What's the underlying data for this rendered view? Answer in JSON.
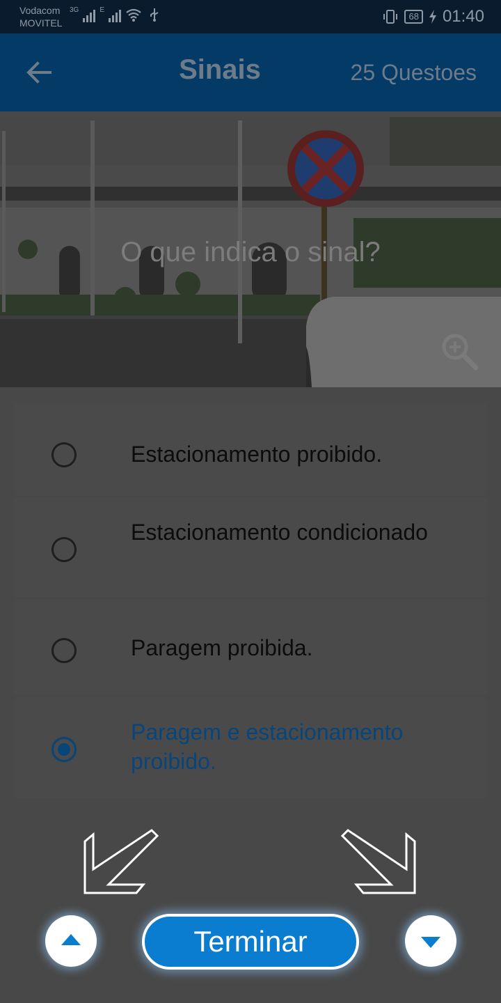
{
  "status_bar": {
    "carrier_1": "Vodacom",
    "carrier_2": "MOVITEL",
    "net_1": "3G",
    "net_2": "E",
    "battery": "68",
    "time": "01:40"
  },
  "app_bar": {
    "title": "Sinais",
    "question_count": "25 Questoes"
  },
  "question": {
    "text": "O que indica o sinal?"
  },
  "options": [
    {
      "label": "Estacionamento proibido.",
      "selected": false
    },
    {
      "label": "Estacionamento condicionado",
      "selected": false
    },
    {
      "label": "Paragem proibida.",
      "selected": false
    },
    {
      "label": "Paragem e estacionamento proibido.",
      "selected": true
    }
  ],
  "bottom": {
    "finish_label": "Terminar"
  },
  "colors": {
    "app_bar": "#043a66",
    "accent": "#0a7dd0",
    "selected_text": "#08457a"
  },
  "icons": [
    "back-arrow-icon",
    "zoom-in-icon",
    "chevron-up-icon",
    "chevron-down-icon"
  ]
}
